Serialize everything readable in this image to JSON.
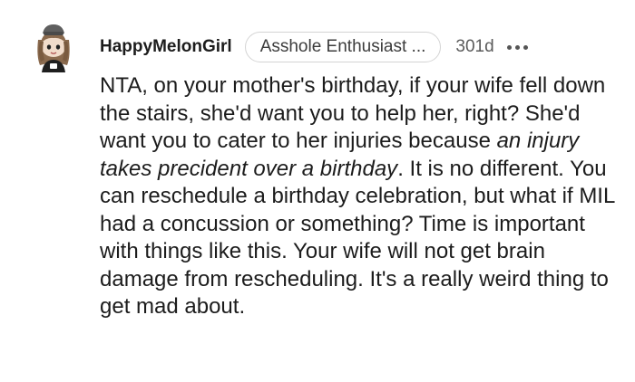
{
  "comment": {
    "username": "HappyMelonGirl",
    "flair": "Asshole Enthusiast ...",
    "age": "301d",
    "more_icon": "more-horizontal-icon",
    "avatar_icon": "snoo-avatar-icon",
    "body": {
      "part1": "NTA, on your mother's birthday, if your wife fell down the stairs, she'd want you to help her, right? She'd want you to cater to her injuries because ",
      "italic": "an injury takes precident over a birthday",
      "part2": ". It is no different. You can reschedule a birthday celebration, but what if MIL had a concussion or something? Time is important with things like this. Your wife will not get brain damage from rescheduling. It's a really weird thing to get mad about."
    }
  }
}
